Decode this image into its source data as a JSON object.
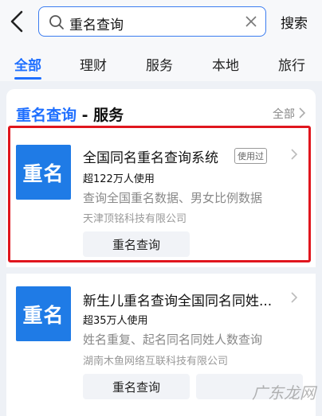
{
  "header": {
    "search_query": "重名查询",
    "search_button": "搜索"
  },
  "tabs": [
    {
      "label": "全部",
      "active": true
    },
    {
      "label": "理财"
    },
    {
      "label": "服务"
    },
    {
      "label": "本地"
    },
    {
      "label": "旅行"
    }
  ],
  "section": {
    "title_highlight": "重名查询",
    "title_rest": " - 服务",
    "all_label": "全部"
  },
  "results": [
    {
      "logo_text": "重名",
      "name": "全国同名重名查询系统",
      "badge": "使用过",
      "users": "超122万人使用",
      "desc": "查询全国重名数据、男女比例数据",
      "company": "天津顶铭科技有限公司",
      "action": "重名查询"
    },
    {
      "logo_text": "重名",
      "name": "新生儿重名查询全国同名同姓...",
      "users": "超35万人使用",
      "desc": "姓名重复、起名同名同姓人数查询",
      "company": "湖南木鱼网络互联科技有限公司",
      "action": "重名查询"
    }
  ],
  "watermark": "广东龙网",
  "colors": {
    "accent": "#1f6fff",
    "highlight_frame": "#e0161e",
    "logo": "#1f7be6"
  }
}
